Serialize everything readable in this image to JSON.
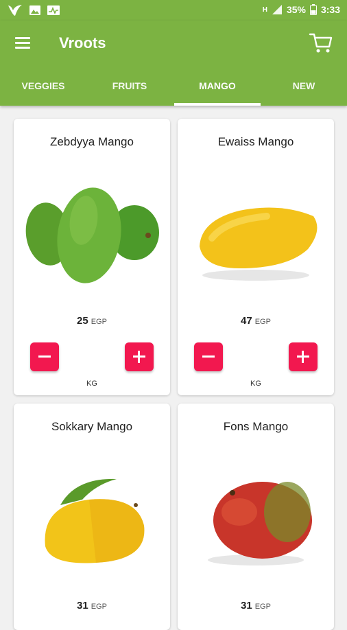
{
  "status_bar": {
    "battery": "35%",
    "time": "3:33",
    "network": "H"
  },
  "app": {
    "title": "Vroots"
  },
  "tabs": [
    {
      "label": "VEGGIES"
    },
    {
      "label": "FRUITS"
    },
    {
      "label": "MANGO",
      "active": true
    },
    {
      "label": "NEW"
    }
  ],
  "products": [
    {
      "name": "Zebdyya Mango",
      "price": "25",
      "currency": "EGP",
      "unit": "KG"
    },
    {
      "name": "Ewaiss Mango",
      "price": "47",
      "currency": "EGP",
      "unit": "KG"
    },
    {
      "name": "Sokkary Mango",
      "price": "31",
      "currency": "EGP"
    },
    {
      "name": "Fons Mango",
      "price": "31",
      "currency": "EGP"
    }
  ],
  "colors": {
    "primary": "#7cb342",
    "accent": "#f2184f",
    "background": "#f1f1f1"
  },
  "icons": [
    "menu-icon",
    "cart-icon",
    "minus-icon",
    "plus-icon"
  ]
}
